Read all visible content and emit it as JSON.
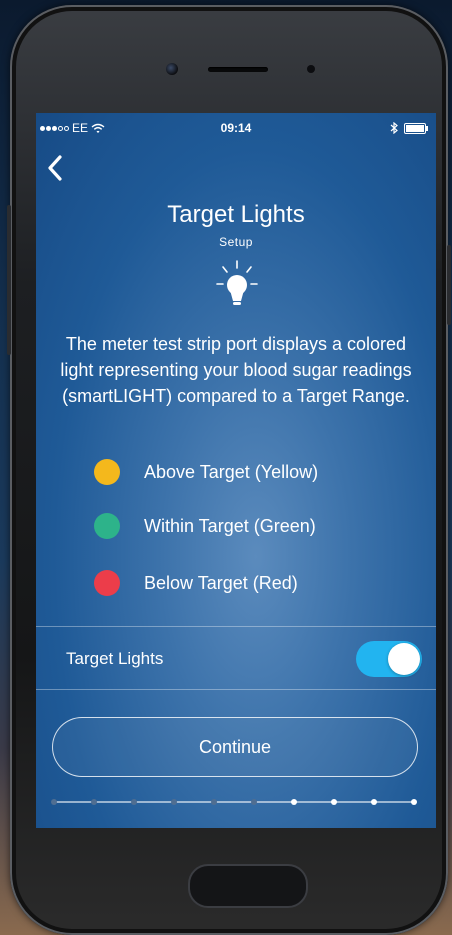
{
  "status_bar": {
    "carrier": "EE",
    "time": "09:14"
  },
  "header": {
    "title": "Target Lights",
    "subtitle": "Setup"
  },
  "description": "The meter test strip port displays a colored light representing your blood sugar readings (smartLIGHT) compared to a Target Range.",
  "legend": [
    {
      "label": "Above Target (Yellow)",
      "color": "#f4b81c"
    },
    {
      "label": "Within Target (Green)",
      "color": "#2db38a"
    },
    {
      "label": "Below Target (Red)",
      "color": "#ec3d4a"
    }
  ],
  "toggle": {
    "label": "Target Lights",
    "on": true,
    "color": "#22b4f0"
  },
  "continue_label": "Continue",
  "progress": {
    "total_steps": 10,
    "current_step": 6
  }
}
